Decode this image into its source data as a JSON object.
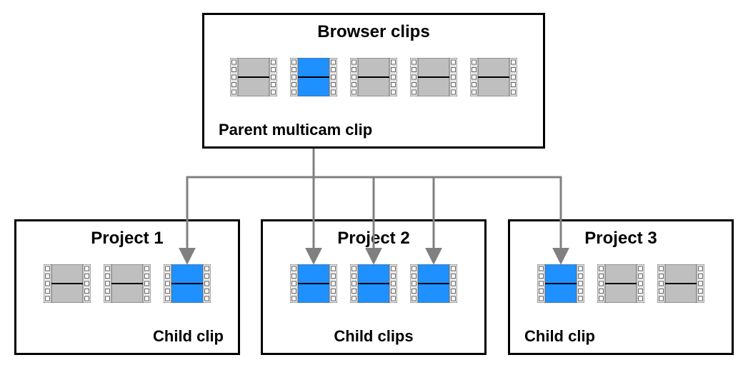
{
  "browser": {
    "title": "Browser clips",
    "caption": "Parent multicam clip",
    "clips": [
      {
        "id": "b1",
        "highlight": false
      },
      {
        "id": "b2",
        "highlight": true
      },
      {
        "id": "b3",
        "highlight": false
      },
      {
        "id": "b4",
        "highlight": false
      },
      {
        "id": "b5",
        "highlight": false
      }
    ]
  },
  "projects": [
    {
      "title": "Project 1",
      "caption_align": "right",
      "caption": "Child clip",
      "clips": [
        {
          "id": "p1c1",
          "highlight": false
        },
        {
          "id": "p1c2",
          "highlight": false
        },
        {
          "id": "p1c3",
          "highlight": true
        }
      ]
    },
    {
      "title": "Project 2",
      "caption_align": "center",
      "caption": "Child clips",
      "clips": [
        {
          "id": "p2c1",
          "highlight": true
        },
        {
          "id": "p2c2",
          "highlight": true
        },
        {
          "id": "p2c3",
          "highlight": true
        }
      ]
    },
    {
      "title": "Project 3",
      "caption_align": "left",
      "caption": "Child clip",
      "clips": [
        {
          "id": "p3c1",
          "highlight": true
        },
        {
          "id": "p3c2",
          "highlight": false
        },
        {
          "id": "p3c3",
          "highlight": false
        }
      ]
    }
  ],
  "arrows": [
    {
      "from": "parent",
      "to": "p1c3"
    },
    {
      "from": "parent",
      "to": "p2c1"
    },
    {
      "from": "parent",
      "to": "p2c2"
    },
    {
      "from": "parent",
      "to": "p2c3"
    },
    {
      "from": "parent",
      "to": "p3c1"
    }
  ]
}
